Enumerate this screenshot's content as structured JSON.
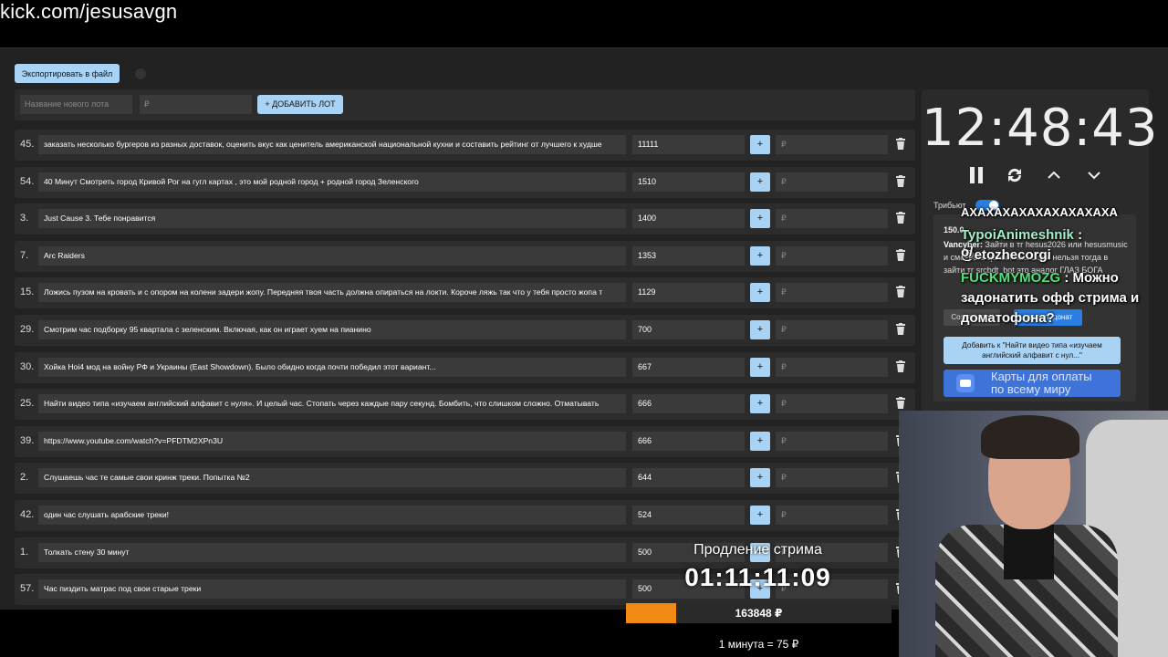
{
  "url": "kick.com/jesusavgn",
  "toolbar": {
    "export_label": "Экспортировать в файл"
  },
  "new_lot": {
    "name_placeholder": "Название нового лота",
    "price_placeholder": "₽",
    "add_label": "+ ДОБАВИТЬ ЛОТ"
  },
  "lots": [
    {
      "num": "45.",
      "title": "заказать несколько бургеров из разных доставок, оценить вкус как ценитель американской национальной кухни и составить рейтинг от лучшего к худше",
      "amount": "11111",
      "plus": "+",
      "price": "₽"
    },
    {
      "num": "54.",
      "title": "40 Минут Смотреть город Кривой Рог на гугл картах , это мой родной город + родной город Зеленского",
      "amount": "1510",
      "plus": "+",
      "price": "₽"
    },
    {
      "num": "3.",
      "title": "Just Cause 3. Тебе понравится",
      "amount": "1400",
      "plus": "+",
      "price": "₽"
    },
    {
      "num": "7.",
      "title": "Arc Raiders",
      "amount": "1353",
      "plus": "+",
      "price": "₽"
    },
    {
      "num": "15.",
      "title": "Ложись пузом на кровать и с опором на колени задери жопу. Передняя твоя часть должна опираться на локти. Короче ляжь так что у тебя просто жопа т",
      "amount": "1129",
      "plus": "+",
      "price": "₽"
    },
    {
      "num": "29.",
      "title": "Смотрим час подборку 95 квартала с зеленским. Включая, как он играет хуем на пианино",
      "amount": "700",
      "plus": "+",
      "price": "₽"
    },
    {
      "num": "30.",
      "title": "Хойка Hoi4 мод на войну РФ и Украины (East Showdown). Было обидно когда почти победил этот вариант...",
      "amount": "667",
      "plus": "+",
      "price": "₽"
    },
    {
      "num": "25.",
      "title": "Найти видео типа «изучаем английский алфавит с нуля». И целый час. Стопать через каждые пару секунд. Бомбить, что слишком сложно. Отматывать",
      "amount": "666",
      "plus": "+",
      "price": "₽"
    },
    {
      "num": "39.",
      "title": "https://www.youtube.com/watch?v=PFDTM2XPn3U",
      "amount": "666",
      "plus": "+",
      "price": "₽"
    },
    {
      "num": "2.",
      "title": "Слушаешь час те самые свои кринж треки. Попытка №2",
      "amount": "644",
      "plus": "+",
      "price": "₽"
    },
    {
      "num": "42.",
      "title": "один час слушать арабские треки!",
      "amount": "524",
      "plus": "+",
      "price": "₽"
    },
    {
      "num": "1.",
      "title": "Толкать стену 30 минут",
      "amount": "500",
      "plus": "+",
      "price": "₽"
    },
    {
      "num": "57.",
      "title": "Час пиздить матрас под свои старые треки",
      "amount": "500",
      "plus": "+",
      "price": "₽"
    }
  ],
  "side": {
    "clock": "12:48:43",
    "tribute_label": "Трибьют",
    "donation_amount": "150.0",
    "donation_user": "Vancyber:",
    "donation_text": "Зайти в тг hesus2026 или hesusmusic и смотреть целый час. Если нельзя тогда в зайти тг srcbdt_bot это аналог ГЛАЗ БОГА",
    "create_lot": "Создать лот",
    "delete_donat": "удалить донат",
    "add_to": "Добавить к \"Найти видео типа «изучаем английский алфавит с нул...\"",
    "pay_text_1": "Карты для оплаты",
    "pay_text_2": "по всему миру"
  },
  "chat": {
    "line1": "АХАХАХАХАХАХАХАХАХА",
    "user1": "TypoiAnimeshnik",
    "msg1": ": @etozhecorgi",
    "msg1b": "o/",
    "user2": "FUCKMYMOZG",
    "msg2": ": Можно задонатить офф стрима и доматофона?"
  },
  "overlay": {
    "timer_label": "Продление стрима",
    "timer_value": "01:11:11:09",
    "total": "163848 ₽",
    "progress_fraction": 0.19,
    "progress_color": "#f08a12",
    "rate": "1 минута = 75 ₽"
  },
  "colors": {
    "accent": "#a9d3f5",
    "toggle": "#2a7de1",
    "panel": "#2c2c2c"
  }
}
